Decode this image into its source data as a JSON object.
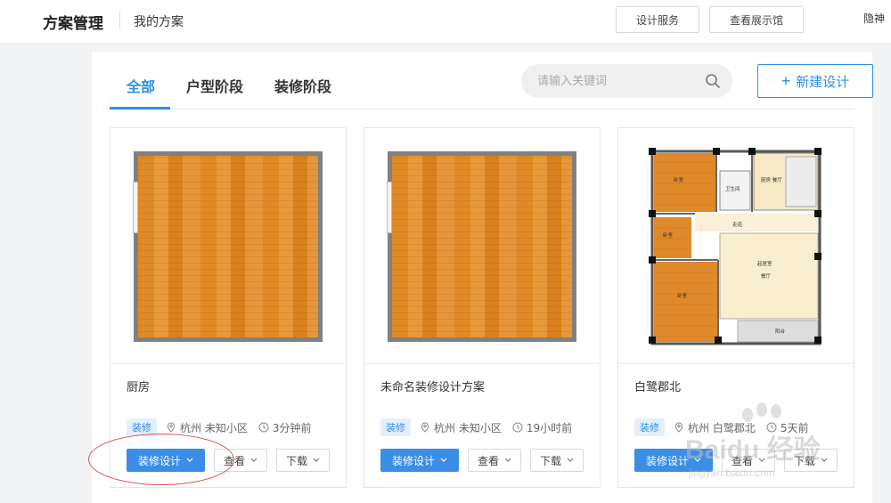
{
  "header": {
    "title": "方案管理",
    "subtitle": "我的方案",
    "design_service": "设计服务",
    "view_showroom": "查看展示馆",
    "user": "隐神"
  },
  "tabs": [
    {
      "label": "全部",
      "active": true
    },
    {
      "label": "户型阶段",
      "active": false
    },
    {
      "label": "装修阶段",
      "active": false
    }
  ],
  "search": {
    "placeholder": "请输入关键词",
    "value": ""
  },
  "new_design": "新建设计",
  "cards": [
    {
      "name": "厨房",
      "tag": "装修",
      "location": "杭州 未知小区",
      "time": "3分钟前",
      "design_btn": "装修设计",
      "view_btn": "查看",
      "download_btn": "下载"
    },
    {
      "name": "未命名装修设计方案",
      "tag": "装修",
      "location": "杭州 未知小区",
      "time": "19小时前",
      "design_btn": "装修设计",
      "view_btn": "查看",
      "download_btn": "下载"
    },
    {
      "name": "白鹭郡北",
      "tag": "装修",
      "location": "杭州 白鹭郡北",
      "time": "5天前",
      "design_btn": "装修设计",
      "view_btn": "查看",
      "download_btn": "下载"
    }
  ],
  "floorplan_labels": {
    "bedroom1": "卧室",
    "bathroom": "卫生间",
    "kitchen": "厨房 餐厅",
    "bedroom2": "卧室",
    "hall": "起居室",
    "dining": "餐厅",
    "balcony": "阳台",
    "corridor": "走道"
  },
  "watermark": {
    "brand": "Baidu 经验",
    "url": "jingyan.baidu.com"
  },
  "colors": {
    "accent": "#2f8ee8",
    "wood": "#e08a27",
    "annotation": "#e05050"
  }
}
